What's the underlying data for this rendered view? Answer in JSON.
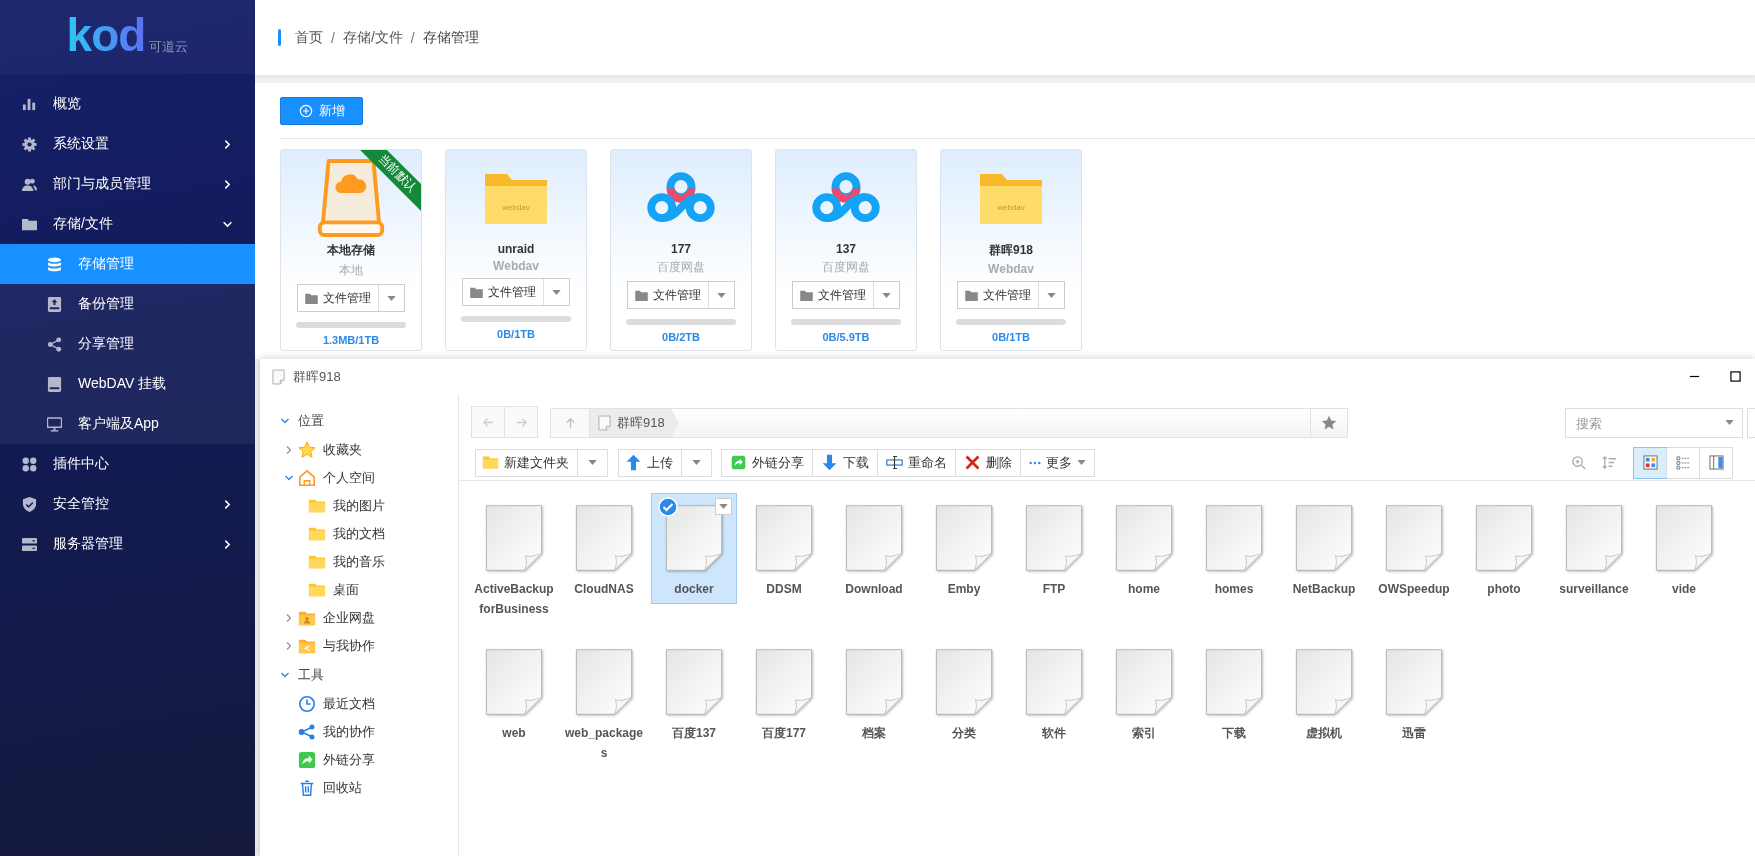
{
  "sidebar": {
    "logo": "kod",
    "logo_caption": "可道云",
    "items": [
      {
        "label": "概览",
        "kind": "link",
        "selected": false
      },
      {
        "label": "系统设置",
        "kind": "group",
        "expanded": false,
        "selected": false
      },
      {
        "label": "部门与成员管理",
        "kind": "group",
        "expanded": false,
        "selected": false
      },
      {
        "label": "存储/文件",
        "kind": "group",
        "expanded": true,
        "selected": false,
        "children": [
          {
            "label": "存储管理",
            "selected": true
          },
          {
            "label": "备份管理",
            "selected": false
          },
          {
            "label": "分享管理",
            "selected": false
          },
          {
            "label": "WebDAV 挂载",
            "selected": false
          },
          {
            "label": "客户端及App",
            "selected": false
          }
        ]
      },
      {
        "label": "插件中心",
        "kind": "link",
        "selected": false
      },
      {
        "label": "安全管控",
        "kind": "group",
        "expanded": false,
        "selected": false
      },
      {
        "label": "服务器管理",
        "kind": "group",
        "expanded": false,
        "selected": false
      }
    ]
  },
  "breadcrumb": {
    "separator": "/",
    "items": [
      "首页",
      "存储/文件",
      "存储管理"
    ]
  },
  "add_button": "新增",
  "storages": [
    {
      "name": "本地存储",
      "type": "本地",
      "kind": "local",
      "badge": "当前默认",
      "action": "文件管理",
      "level": 0,
      "usage": "1.3MB/1TB"
    },
    {
      "name": "unraid",
      "type": "Webdav",
      "kind": "webdav",
      "icon_label": "webdav",
      "action": "文件管理",
      "level": 0,
      "usage": "0B/1TB"
    },
    {
      "name": "177",
      "type": "百度网盘",
      "kind": "baidu",
      "action": "文件管理",
      "level": 0,
      "usage": "0B/2TB"
    },
    {
      "name": "137",
      "type": "百度网盘",
      "kind": "baidu",
      "action": "文件管理",
      "level": 0,
      "usage": "0B/5.9TB"
    },
    {
      "name": "群晖918",
      "type": "Webdav",
      "kind": "webdav",
      "icon_label": "webdav",
      "action": "文件管理",
      "level": 0,
      "usage": "0B/1TB"
    }
  ],
  "window": {
    "title": "群晖918",
    "path": [
      "群晖918"
    ],
    "search_placeholder": "搜索",
    "tree": {
      "sections": [
        {
          "label": "位置",
          "expanded": true,
          "items": [
            {
              "label": "收藏夹",
              "kind": "favorites",
              "expanded": false
            },
            {
              "label": "个人空间",
              "kind": "home",
              "expanded": true,
              "children": [
                {
                  "label": "我的图片"
                },
                {
                  "label": "我的文档"
                },
                {
                  "label": "我的音乐"
                },
                {
                  "label": "桌面"
                }
              ]
            },
            {
              "label": "企业网盘",
              "kind": "company",
              "expanded": false
            },
            {
              "label": "与我协作",
              "kind": "shared",
              "expanded": false
            }
          ]
        },
        {
          "label": "工具",
          "expanded": true,
          "items": [
            {
              "label": "最近文档",
              "kind": "recent"
            },
            {
              "label": "我的协作",
              "kind": "collab"
            },
            {
              "label": "外链分享",
              "kind": "link-share"
            },
            {
              "label": "回收站",
              "kind": "trash"
            }
          ]
        }
      ]
    },
    "toolbar_groups": [
      {
        "buttons": [
          {
            "label": "新建文件夹",
            "kind": "new-folder",
            "dropdown": true
          }
        ]
      },
      {
        "buttons": [
          {
            "label": "上传",
            "kind": "upload",
            "dropdown": true
          }
        ]
      },
      {
        "buttons": [
          {
            "label": "外链分享",
            "kind": "link-share",
            "dropdown": false
          },
          {
            "label": "下载",
            "kind": "download",
            "dropdown": false
          },
          {
            "label": "重命名",
            "kind": "rename",
            "dropdown": false
          },
          {
            "label": "删除",
            "kind": "delete",
            "dropdown": false
          },
          {
            "label": "更多",
            "kind": "more",
            "dropdown": true
          }
        ]
      }
    ],
    "view_modes": [
      {
        "kind": "icons",
        "selected": true
      },
      {
        "kind": "list",
        "selected": false
      },
      {
        "kind": "split",
        "selected": false
      }
    ],
    "files": [
      {
        "name": "ActiveBackupforBusiness",
        "selected": false
      },
      {
        "name": "CloudNAS",
        "selected": false
      },
      {
        "name": "docker",
        "selected": true
      },
      {
        "name": "DDSM",
        "selected": false
      },
      {
        "name": "Download",
        "selected": false
      },
      {
        "name": "Emby",
        "selected": false
      },
      {
        "name": "FTP",
        "selected": false
      },
      {
        "name": "home",
        "selected": false
      },
      {
        "name": "homes",
        "selected": false
      },
      {
        "name": "NetBackup",
        "selected": false
      },
      {
        "name": "OWSpeedup",
        "selected": false
      },
      {
        "name": "photo",
        "selected": false
      },
      {
        "name": "surveillance",
        "selected": false
      },
      {
        "name": "vide",
        "selected": false
      },
      {
        "name": "web",
        "selected": false
      },
      {
        "name": "web_packages",
        "selected": false
      },
      {
        "name": "百度137",
        "selected": false
      },
      {
        "name": "百度177",
        "selected": false
      },
      {
        "name": "档案",
        "selected": false
      },
      {
        "name": "分类",
        "selected": false
      },
      {
        "name": "软件",
        "selected": false
      },
      {
        "name": "索引",
        "selected": false
      },
      {
        "name": "下载",
        "selected": false
      },
      {
        "name": "虚拟机",
        "selected": false
      },
      {
        "name": "迅雷",
        "selected": false
      }
    ]
  }
}
